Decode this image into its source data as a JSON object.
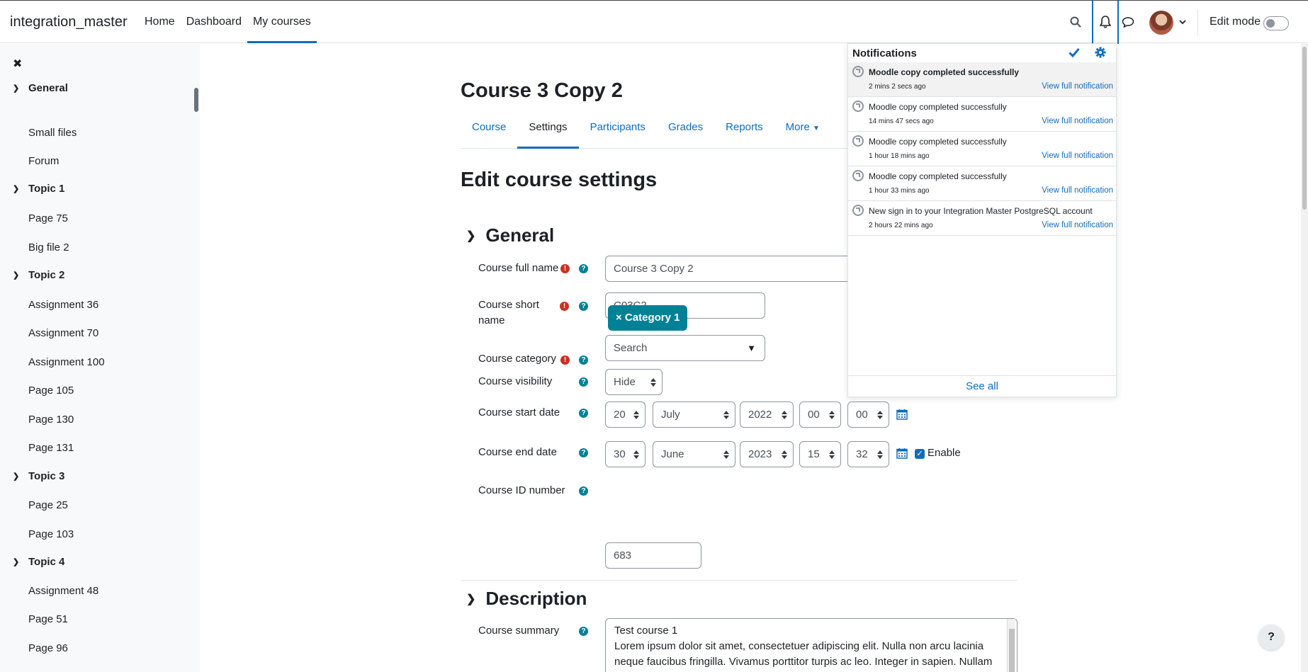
{
  "navbar": {
    "brand": "integration_master",
    "nav": [
      "Home",
      "Dashboard",
      "My courses"
    ],
    "edit_mode_label": "Edit mode"
  },
  "drawer": {
    "sections": [
      {
        "title": "General",
        "items": [
          "Small files",
          "Forum"
        ]
      },
      {
        "title": "Topic 1",
        "items": [
          "Page 75",
          "Big file 2"
        ]
      },
      {
        "title": "Topic 2",
        "items": [
          "Assignment 36",
          "Assignment 70",
          "Assignment 100",
          "Page 105",
          "Page 130",
          "Page 131"
        ]
      },
      {
        "title": "Topic 3",
        "items": [
          "Page 25",
          "Page 103"
        ]
      },
      {
        "title": "Topic 4",
        "items": [
          "Assignment 48",
          "Page 51",
          "Page 96"
        ]
      }
    ]
  },
  "course": {
    "title": "Course 3 Copy 2",
    "tabs": [
      "Course",
      "Settings",
      "Participants",
      "Grades",
      "Reports",
      "More"
    ],
    "page_heading": "Edit course settings"
  },
  "form": {
    "general_heading": "General",
    "full_name_label": "Course full name",
    "full_name_value": "Course 3 Copy 2",
    "short_name_label": "Course short name",
    "short_name_value": "C03C2",
    "category_label": "Course category",
    "category_badge": "× Category 1",
    "category_search_placeholder": "Search",
    "category_search_arrow": "▼",
    "visibility_label": "Course visibility",
    "visibility_value": "Hide",
    "start_label": "Course start date",
    "start": {
      "day": "20",
      "month": "July",
      "year": "2022",
      "hour": "00",
      "minute": "00"
    },
    "end_label": "Course end date",
    "end": {
      "day": "30",
      "month": "June",
      "year": "2023",
      "hour": "15",
      "minute": "32"
    },
    "end_enable_label": "Enable",
    "idnumber_label": "Course ID number",
    "idnumber_value": "683",
    "description_heading": "Description",
    "summary_label": "Course summary",
    "summary_text": "Test course 1\nLorem ipsum dolor sit amet, consectetuer adipiscing elit. Nulla non arcu lacinia neque faucibus fringilla. Vivamus porttitor turpis ac leo. Integer in sapien. Nullam"
  },
  "notifications": {
    "title": "Notifications",
    "items": [
      {
        "subject": "Moodle copy completed successfully",
        "time": "2 mins 2 secs ago",
        "link": "View full notification",
        "unread": true
      },
      {
        "subject": "Moodle copy completed successfully",
        "time": "14 mins 47 secs ago",
        "link": "View full notification",
        "unread": false
      },
      {
        "subject": "Moodle copy completed successfully",
        "time": "1 hour 18 mins ago",
        "link": "View full notification",
        "unread": false
      },
      {
        "subject": "Moodle copy completed successfully",
        "time": "1 hour 33 mins ago",
        "link": "View full notification",
        "unread": false
      },
      {
        "subject": "New sign in to your Integration Master PostgreSQL account",
        "time": "2 hours 22 mins ago",
        "link": "View full notification",
        "unread": false
      }
    ],
    "see_all": "See all"
  },
  "icons": {
    "accent": "#0f6cbf",
    "help_color": "#008196",
    "required_color": "#ca3120"
  },
  "help_button": "?"
}
